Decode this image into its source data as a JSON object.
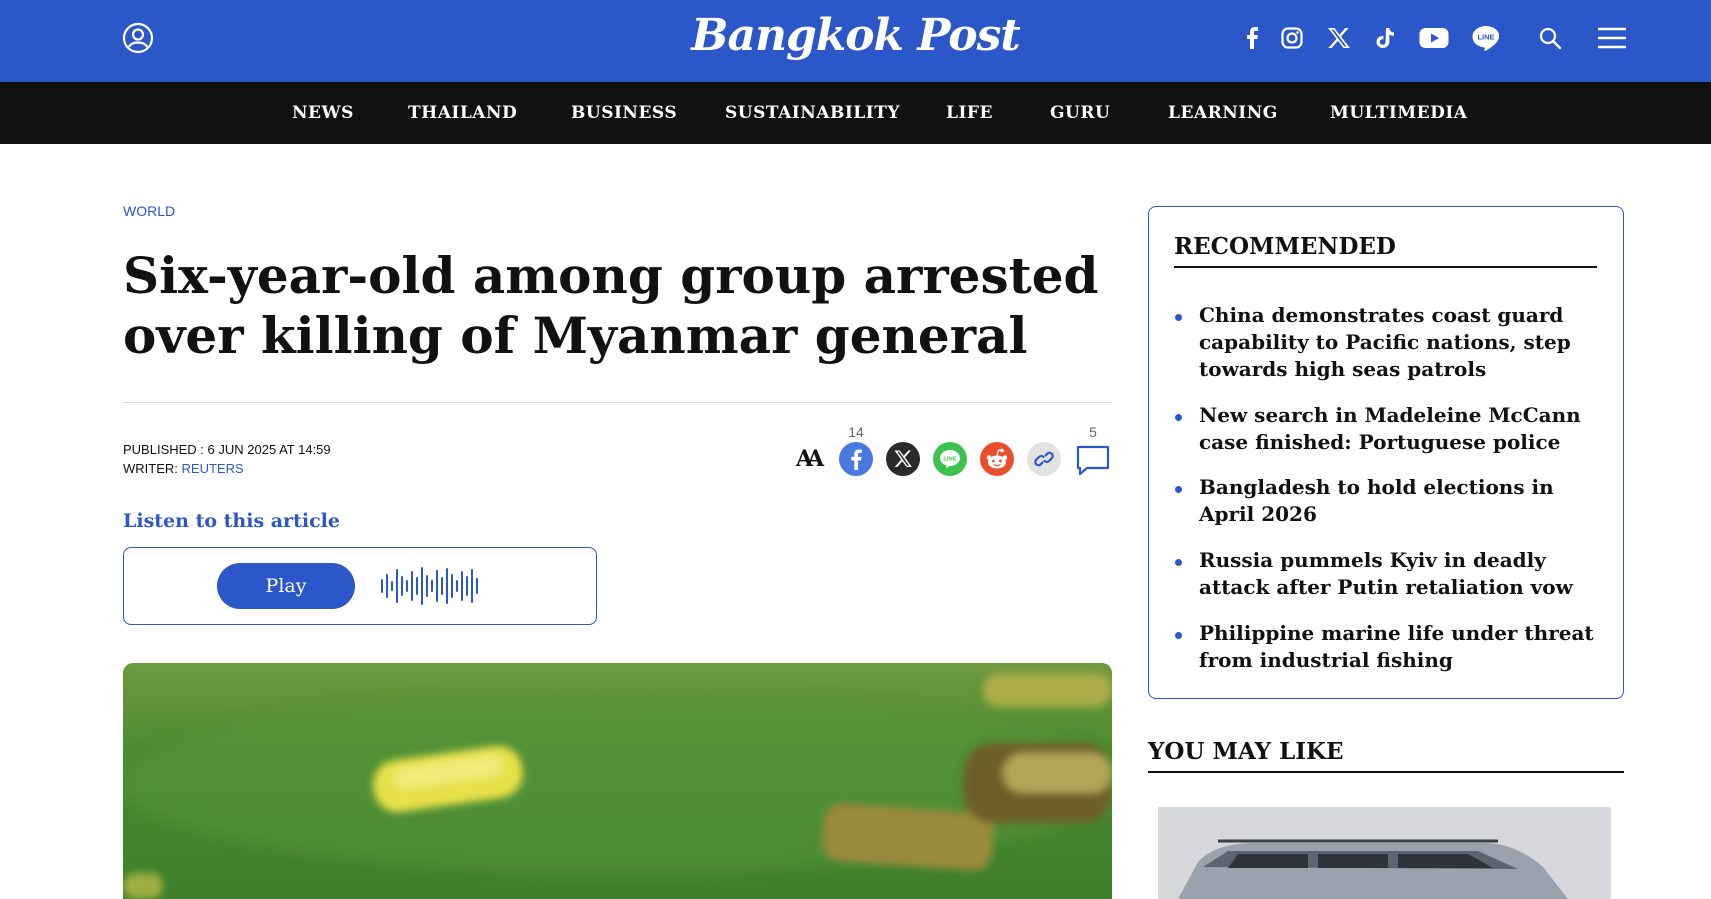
{
  "header": {
    "logo": "Bangkok Post",
    "icons": [
      "user-icon",
      "facebook-icon",
      "instagram-icon",
      "x-icon",
      "tiktok-icon",
      "youtube-icon",
      "line-icon",
      "search-icon",
      "menu-icon"
    ],
    "line_badge": "LINE",
    "brand_color": "#2b57c8"
  },
  "nav": {
    "items": [
      "NEWS",
      "THAILAND",
      "BUSINESS",
      "SUSTAINABILITY",
      "LIFE",
      "GURU",
      "LEARNING",
      "MULTIMEDIA"
    ]
  },
  "article": {
    "section": "WORLD",
    "headline": "Six-year-old among group arrested over killing of Myanmar general",
    "published_label": "PUBLISHED :",
    "published_value": "6 JUN 2025 AT 14:59",
    "writer_label": "WRITER:",
    "writer_value": "REUTERS",
    "share_count": "14",
    "comment_count": "5",
    "font_size_glyph": "AA",
    "listen_label": "Listen to this article",
    "play_label": "Play"
  },
  "sidebar": {
    "recommended_title": "RECOMMENDED",
    "recommended": [
      "China demonstrates coast guard capability to Pacific nations, step towards high seas patrols",
      "New search in Madeleine McCann case finished: Portuguese police",
      "Bangladesh to hold elections in April 2026",
      "Russia pummels Kyiv in deadly attack after Putin retaliation vow",
      "Philippine marine life under threat from industrial fishing"
    ],
    "you_may_like_title": "YOU MAY LIKE"
  }
}
